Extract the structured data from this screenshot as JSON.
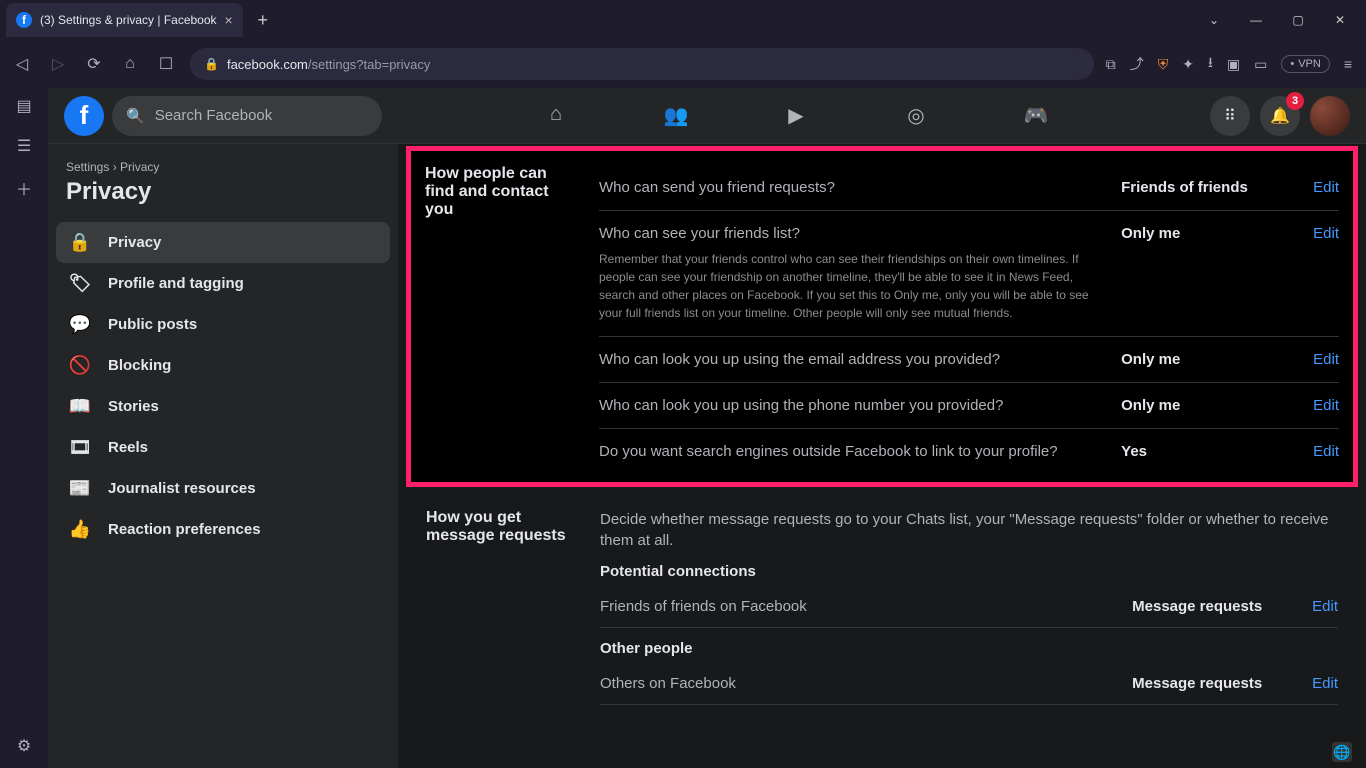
{
  "browser": {
    "tab_title": "(3) Settings & privacy | Facebook",
    "url_host": "facebook.com",
    "url_path": "/settings?tab=privacy",
    "vpn_label": "VPN"
  },
  "fb_header": {
    "search_placeholder": "Search Facebook",
    "notification_badge": "3"
  },
  "breadcrumb": {
    "root": "Settings",
    "sep": "›",
    "current": "Privacy"
  },
  "page_title": "Privacy",
  "sidebar_items": [
    {
      "icon": "lock",
      "label": "Privacy",
      "active": true
    },
    {
      "icon": "tag",
      "label": "Profile and tagging"
    },
    {
      "icon": "posts",
      "label": "Public posts"
    },
    {
      "icon": "block",
      "label": "Blocking"
    },
    {
      "icon": "book",
      "label": "Stories"
    },
    {
      "icon": "reels",
      "label": "Reels"
    },
    {
      "icon": "news",
      "label": "Journalist resources"
    },
    {
      "icon": "react",
      "label": "Reaction preferences"
    }
  ],
  "section_findcontact": {
    "title": "How people can find and contact you",
    "rows": [
      {
        "q": "Who can send you friend requests?",
        "val": "Friends of friends",
        "edit": "Edit"
      },
      {
        "q": "Who can see your friends list?",
        "val": "Only me",
        "edit": "Edit",
        "desc": "Remember that your friends control who can see their friendships on their own timelines. If people can see your friendship on another timeline, they'll be able to see it in News Feed, search and other places on Facebook. If you set this to Only me, only you will be able to see your full friends list on your timeline. Other people will only see mutual friends."
      },
      {
        "q": "Who can look you up using the email address you provided?",
        "val": "Only me",
        "edit": "Edit"
      },
      {
        "q": "Who can look you up using the phone number you provided?",
        "val": "Only me",
        "edit": "Edit"
      },
      {
        "q": "Do you want search engines outside Facebook to link to your profile?",
        "val": "Yes",
        "edit": "Edit"
      }
    ]
  },
  "section_messages": {
    "title": "How you get message requests",
    "desc": "Decide whether message requests go to your Chats list, your \"Message requests\" folder or whether to receive them at all.",
    "group1_title": "Potential connections",
    "group1_rows": [
      {
        "q": "Friends of friends on Facebook",
        "val": "Message requests",
        "edit": "Edit"
      }
    ],
    "group2_title": "Other people",
    "group2_rows": [
      {
        "q": "Others on Facebook",
        "val": "Message requests",
        "edit": "Edit"
      }
    ]
  }
}
